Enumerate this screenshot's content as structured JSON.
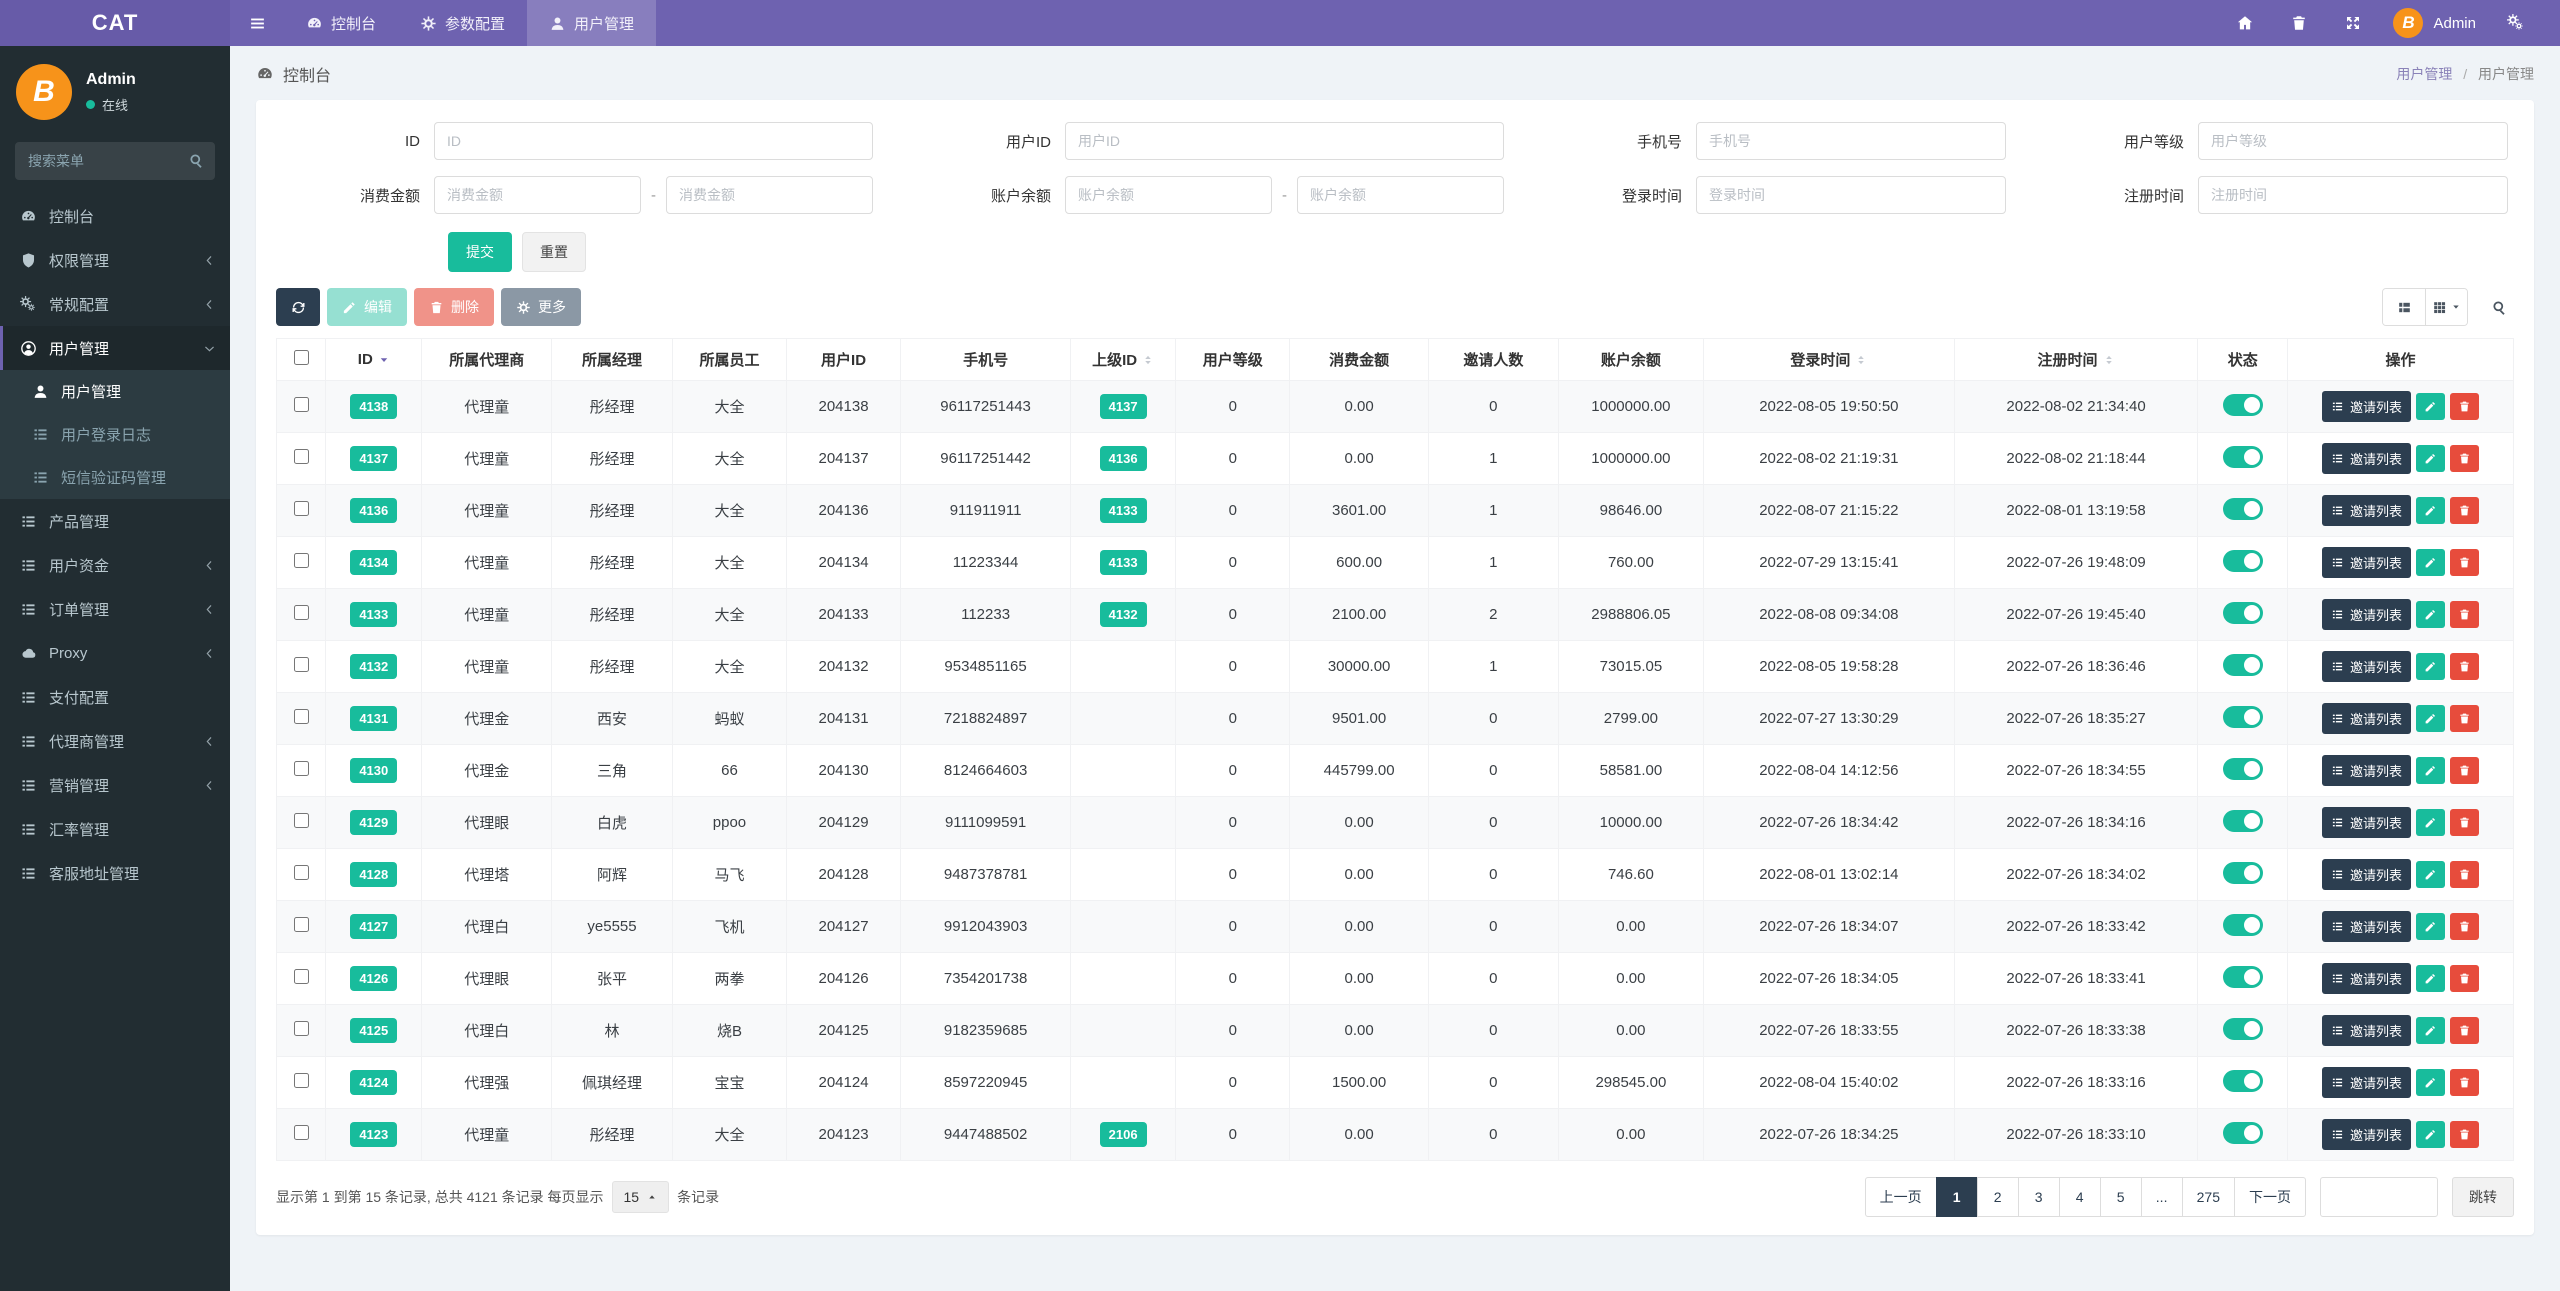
{
  "navbar": {
    "brand": "CAT",
    "tabs": [
      {
        "label": "控制台",
        "icon": "tachometer",
        "active": false
      },
      {
        "label": "参数配置",
        "icon": "gear",
        "active": false
      },
      {
        "label": "用户管理",
        "icon": "user",
        "active": true
      }
    ],
    "user_name": "Admin"
  },
  "sidebar": {
    "user_name": "Admin",
    "user_status": "在线",
    "search_placeholder": "搜索菜单",
    "menu": [
      {
        "label": "控制台",
        "icon": "tachometer",
        "arrow": null
      },
      {
        "label": "权限管理",
        "icon": "shield",
        "arrow": "left"
      },
      {
        "label": "常规配置",
        "icon": "cogs",
        "arrow": "left"
      },
      {
        "label": "用户管理",
        "icon": "user-circle",
        "arrow": "down",
        "active": true,
        "children": [
          {
            "label": "用户管理",
            "icon": "user",
            "active": true
          },
          {
            "label": "用户登录日志",
            "icon": "list",
            "active": false
          },
          {
            "label": "短信验证码管理",
            "icon": "list",
            "active": false
          }
        ]
      },
      {
        "label": "产品管理",
        "icon": "list",
        "arrow": null
      },
      {
        "label": "用户资金",
        "icon": "list",
        "arrow": "left"
      },
      {
        "label": "订单管理",
        "icon": "list",
        "arrow": "left"
      },
      {
        "label": "Proxy",
        "icon": "cloud",
        "arrow": "left"
      },
      {
        "label": "支付配置",
        "icon": "list",
        "arrow": null
      },
      {
        "label": "代理商管理",
        "icon": "list",
        "arrow": "left"
      },
      {
        "label": "营销管理",
        "icon": "list",
        "arrow": "left"
      },
      {
        "label": "汇率管理",
        "icon": "list",
        "arrow": null
      },
      {
        "label": "客服地址管理",
        "icon": "list",
        "arrow": null
      }
    ]
  },
  "header": {
    "title": "控制台",
    "breadcrumb": [
      "用户管理",
      "用户管理"
    ]
  },
  "filter_form": {
    "id": {
      "label": "ID",
      "placeholder": "ID"
    },
    "user_id": {
      "label": "用户ID",
      "placeholder": "用户ID"
    },
    "phone": {
      "label": "手机号",
      "placeholder": "手机号"
    },
    "level": {
      "label": "用户等级",
      "placeholder": "用户等级"
    },
    "consume": {
      "label": "消费金额",
      "placeholder_min": "消费金额",
      "placeholder_max": "消费金额",
      "separator": "-"
    },
    "balance": {
      "label": "账户余额",
      "placeholder_min": "账户余额",
      "placeholder_max": "账户余额",
      "separator": "-"
    },
    "login_time": {
      "label": "登录时间",
      "placeholder": "登录时间"
    },
    "reg_time": {
      "label": "注册时间",
      "placeholder": "注册时间"
    },
    "submit_label": "提交",
    "reset_label": "重置"
  },
  "toolbar": {
    "edit_label": "编辑",
    "delete_label": "删除",
    "more_label": "更多"
  },
  "table": {
    "ops_invite_label": "邀请列表",
    "columns": [
      {
        "key": "check",
        "label": "",
        "width": "2.2%"
      },
      {
        "key": "id",
        "label": "ID",
        "width": "4.3%",
        "sort": "active-desc"
      },
      {
        "key": "agent",
        "label": "所属代理商",
        "width": "5.8%"
      },
      {
        "key": "manager",
        "label": "所属经理",
        "width": "5.4%"
      },
      {
        "key": "staff",
        "label": "所属员工",
        "width": "5.1%"
      },
      {
        "key": "user_id",
        "label": "用户ID",
        "width": "5.1%"
      },
      {
        "key": "phone",
        "label": "手机号",
        "width": "7.6%"
      },
      {
        "key": "parent_id",
        "label": "上级ID",
        "width": "4.7%",
        "sort": "both"
      },
      {
        "key": "level",
        "label": "用户等级",
        "width": "5.1%"
      },
      {
        "key": "consume",
        "label": "消费金额",
        "width": "6.2%"
      },
      {
        "key": "invites",
        "label": "邀请人数",
        "width": "5.8%"
      },
      {
        "key": "balance",
        "label": "账户余额",
        "width": "6.5%"
      },
      {
        "key": "login_time",
        "label": "登录时间",
        "width": "11.2%",
        "sort": "both"
      },
      {
        "key": "reg_time",
        "label": "注册时间",
        "width": "10.9%",
        "sort": "both"
      },
      {
        "key": "status",
        "label": "状态",
        "width": "4.0%"
      },
      {
        "key": "ops",
        "label": "操作",
        "width": "10.1%"
      }
    ],
    "rows": [
      {
        "id": "4138",
        "agent": "代理童",
        "manager": "彤经理",
        "staff": "大全",
        "user_id": "204138",
        "phone": "96117251443",
        "parent_id": "4137",
        "level": "0",
        "consume": "0.00",
        "invites": "0",
        "balance": "1000000.00",
        "login_time": "2022-08-05 19:50:50",
        "reg_time": "2022-08-02 21:34:40",
        "status_on": true
      },
      {
        "id": "4137",
        "agent": "代理童",
        "manager": "彤经理",
        "staff": "大全",
        "user_id": "204137",
        "phone": "96117251442",
        "parent_id": "4136",
        "level": "0",
        "consume": "0.00",
        "invites": "1",
        "balance": "1000000.00",
        "login_time": "2022-08-02 21:19:31",
        "reg_time": "2022-08-02 21:18:44",
        "status_on": true
      },
      {
        "id": "4136",
        "agent": "代理童",
        "manager": "彤经理",
        "staff": "大全",
        "user_id": "204136",
        "phone": "911911911",
        "parent_id": "4133",
        "level": "0",
        "consume": "3601.00",
        "invites": "1",
        "balance": "98646.00",
        "login_time": "2022-08-07 21:15:22",
        "reg_time": "2022-08-01 13:19:58",
        "status_on": true
      },
      {
        "id": "4134",
        "agent": "代理童",
        "manager": "彤经理",
        "staff": "大全",
        "user_id": "204134",
        "phone": "11223344",
        "parent_id": "4133",
        "level": "0",
        "consume": "600.00",
        "invites": "1",
        "balance": "760.00",
        "login_time": "2022-07-29 13:15:41",
        "reg_time": "2022-07-26 19:48:09",
        "status_on": true
      },
      {
        "id": "4133",
        "agent": "代理童",
        "manager": "彤经理",
        "staff": "大全",
        "user_id": "204133",
        "phone": "112233",
        "parent_id": "4132",
        "level": "0",
        "consume": "2100.00",
        "invites": "2",
        "balance": "2988806.05",
        "login_time": "2022-08-08 09:34:08",
        "reg_time": "2022-07-26 19:45:40",
        "status_on": true
      },
      {
        "id": "4132",
        "agent": "代理童",
        "manager": "彤经理",
        "staff": "大全",
        "user_id": "204132",
        "phone": "9534851165",
        "parent_id": "",
        "level": "0",
        "consume": "30000.00",
        "invites": "1",
        "balance": "73015.05",
        "login_time": "2022-08-05 19:58:28",
        "reg_time": "2022-07-26 18:36:46",
        "status_on": true
      },
      {
        "id": "4131",
        "agent": "代理金",
        "manager": "西安",
        "staff": "蚂蚁",
        "user_id": "204131",
        "phone": "7218824897",
        "parent_id": "",
        "level": "0",
        "consume": "9501.00",
        "invites": "0",
        "balance": "2799.00",
        "login_time": "2022-07-27 13:30:29",
        "reg_time": "2022-07-26 18:35:27",
        "status_on": true
      },
      {
        "id": "4130",
        "agent": "代理金",
        "manager": "三角",
        "staff": "66",
        "user_id": "204130",
        "phone": "8124664603",
        "parent_id": "",
        "level": "0",
        "consume": "445799.00",
        "invites": "0",
        "balance": "58581.00",
        "login_time": "2022-08-04 14:12:56",
        "reg_time": "2022-07-26 18:34:55",
        "status_on": true
      },
      {
        "id": "4129",
        "agent": "代理眼",
        "manager": "白虎",
        "staff": "ppoo",
        "user_id": "204129",
        "phone": "9111099591",
        "parent_id": "",
        "level": "0",
        "consume": "0.00",
        "invites": "0",
        "balance": "10000.00",
        "login_time": "2022-07-26 18:34:42",
        "reg_time": "2022-07-26 18:34:16",
        "status_on": true
      },
      {
        "id": "4128",
        "agent": "代理塔",
        "manager": "阿辉",
        "staff": "马飞",
        "user_id": "204128",
        "phone": "9487378781",
        "parent_id": "",
        "level": "0",
        "consume": "0.00",
        "invites": "0",
        "balance": "746.60",
        "login_time": "2022-08-01 13:02:14",
        "reg_time": "2022-07-26 18:34:02",
        "status_on": true
      },
      {
        "id": "4127",
        "agent": "代理白",
        "manager": "ye5555",
        "staff": "飞机",
        "user_id": "204127",
        "phone": "9912043903",
        "parent_id": "",
        "level": "0",
        "consume": "0.00",
        "invites": "0",
        "balance": "0.00",
        "login_time": "2022-07-26 18:34:07",
        "reg_time": "2022-07-26 18:33:42",
        "status_on": true
      },
      {
        "id": "4126",
        "agent": "代理眼",
        "manager": "张平",
        "staff": "两拳",
        "user_id": "204126",
        "phone": "7354201738",
        "parent_id": "",
        "level": "0",
        "consume": "0.00",
        "invites": "0",
        "balance": "0.00",
        "login_time": "2022-07-26 18:34:05",
        "reg_time": "2022-07-26 18:33:41",
        "status_on": true
      },
      {
        "id": "4125",
        "agent": "代理白",
        "manager": "林",
        "staff": "烧B",
        "user_id": "204125",
        "phone": "9182359685",
        "parent_id": "",
        "level": "0",
        "consume": "0.00",
        "invites": "0",
        "balance": "0.00",
        "login_time": "2022-07-26 18:33:55",
        "reg_time": "2022-07-26 18:33:38",
        "status_on": true
      },
      {
        "id": "4124",
        "agent": "代理强",
        "manager": "佩琪经理",
        "staff": "宝宝",
        "user_id": "204124",
        "phone": "8597220945",
        "parent_id": "",
        "level": "0",
        "consume": "1500.00",
        "invites": "0",
        "balance": "298545.00",
        "login_time": "2022-08-04 15:40:02",
        "reg_time": "2022-07-26 18:33:16",
        "status_on": true
      },
      {
        "id": "4123",
        "agent": "代理童",
        "manager": "彤经理",
        "staff": "大全",
        "user_id": "204123",
        "phone": "9447488502",
        "parent_id": "2106",
        "level": "0",
        "consume": "0.00",
        "invites": "0",
        "balance": "0.00",
        "login_time": "2022-07-26 18:34:25",
        "reg_time": "2022-07-26 18:33:10",
        "status_on": true
      }
    ]
  },
  "pagination": {
    "info_prefix": "显示第 1 到第 15 条记录, 总共 4121 条记录 每页显示",
    "page_size": "15",
    "info_suffix": "条记录",
    "prev_label": "上一页",
    "next_label": "下一页",
    "pages": [
      "1",
      "2",
      "3",
      "4",
      "5",
      "...",
      "275"
    ],
    "active_page": "1",
    "jump_label": "跳转"
  },
  "colors": {
    "accent_green": "#18bc9c",
    "navy": "#2c3e50",
    "red": "#e74c3c",
    "purple": "#6e62b0",
    "orange": "#f7931a"
  }
}
